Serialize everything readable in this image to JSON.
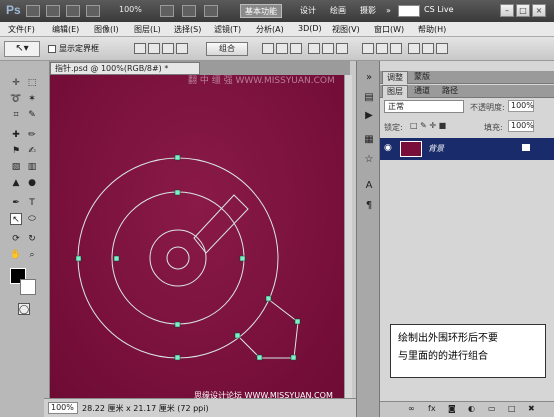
{
  "titlebar": {
    "app_logo": "Ps",
    "zoom": "100%",
    "workspaces": [
      "基本功能",
      "设计",
      "绘画",
      "摄影"
    ],
    "active_workspace": 0,
    "more": "»",
    "cs_live": "CS Live",
    "window_buttons": [
      "–",
      "□",
      "×"
    ]
  },
  "menubar": {
    "items": [
      "文件(F)",
      "编辑(E)",
      "图像(I)",
      "图层(L)",
      "选择(S)",
      "滤镜(T)",
      "分析(A)",
      "3D(D)",
      "视图(V)",
      "窗口(W)",
      "帮助(H)"
    ]
  },
  "options": {
    "show_bounding_box": "显示定界框",
    "combine_button": "组合"
  },
  "document": {
    "tab_title": "指针.psd @ 100%(RGB/8#) *",
    "zoom_status": "100%",
    "dimensions": "28.22 厘米 x 21.17 厘米 (72 ppi)",
    "watermark_top": "翻 中 缰 强 WWW.MISSYUAN.COM",
    "watermark_bottom": "思缘设计论坛  WWW.MISSYUAN.COM"
  },
  "panels": {
    "top_tabs": [
      "调整",
      "蒙版"
    ],
    "layer_tabs": [
      "图层",
      "通道",
      "路径"
    ],
    "blend_mode": "正常",
    "opacity_label": "不透明度:",
    "opacity_value": "100%",
    "lock_label": "锁定:",
    "fill_label": "填充:",
    "fill_value": "100%",
    "layer_name": "背景"
  },
  "caption": {
    "line1": "绘制出外围环形后不要",
    "line2": "与里面的的进行组合"
  },
  "colors": {
    "canvas": "#7a0f3c",
    "layer_selected": "#1a2b6b",
    "path_stroke": "#d9e6e6",
    "anchor": "#7ef0c8"
  }
}
